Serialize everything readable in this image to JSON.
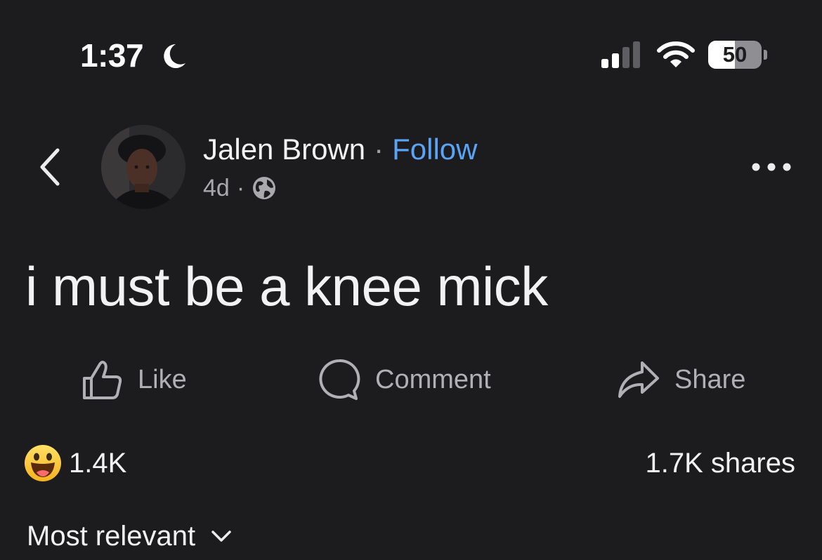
{
  "status_bar": {
    "time": "1:37",
    "focus_icon": "moon-icon",
    "signal_icon": "cellular-signal-icon",
    "wifi_icon": "wifi-icon",
    "battery_level": "50",
    "battery_fraction": 0.5
  },
  "post": {
    "author_name": "Jalen Brown",
    "header_separator": "·",
    "follow_label": "Follow",
    "age": "4d",
    "meta_separator": "·",
    "audience_icon": "globe-icon",
    "text": "i must be a knee mick"
  },
  "actions": {
    "like_label": "Like",
    "comment_label": "Comment",
    "share_label": "Share"
  },
  "stats": {
    "reaction_emoji_icon": "haha-reaction-icon",
    "reaction_count": "1.4K",
    "shares": "1.7K shares"
  },
  "comments": {
    "sort_label": "Most relevant",
    "sort_icon": "chevron-down-icon"
  },
  "colors": {
    "background": "#1c1c1e",
    "text_primary": "#f2f2f4",
    "text_secondary": "#a8a8ad",
    "follow_link": "#5aa3f5",
    "icon_gray": "#b0b0b5"
  }
}
